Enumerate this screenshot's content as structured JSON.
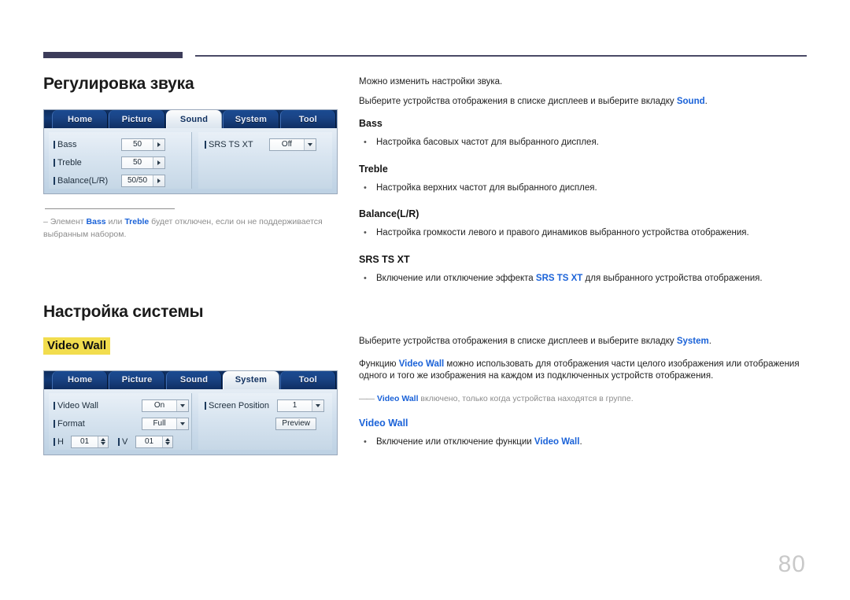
{
  "page": {
    "number": "80"
  },
  "sound_section": {
    "title": "Регулировка звука",
    "panel": {
      "tabs": [
        {
          "label": "Home",
          "active": false
        },
        {
          "label": "Picture",
          "active": false
        },
        {
          "label": "Sound",
          "active": true
        },
        {
          "label": "System",
          "active": false
        },
        {
          "label": "Tool",
          "active": false
        }
      ],
      "left_rows": [
        {
          "label": "Bass",
          "value": "50",
          "control": "stepper-right"
        },
        {
          "label": "Treble",
          "value": "50",
          "control": "stepper-right"
        },
        {
          "label": "Balance(L/R)",
          "value": "50/50",
          "control": "stepper-right"
        }
      ],
      "right_rows": [
        {
          "label": "SRS TS XT",
          "value": "Off",
          "control": "dropdown"
        }
      ]
    },
    "note": {
      "dash": "–",
      "part1": "Элемент ",
      "bold1": "Bass",
      "part2": " или ",
      "bold2": "Treble",
      "part3": " будет отключен, если он не поддерживается выбранным набором."
    }
  },
  "system_section": {
    "title": "Настройка системы",
    "highlight_label": "Video Wall",
    "panel": {
      "tabs": [
        {
          "label": "Home",
          "active": false
        },
        {
          "label": "Picture",
          "active": false
        },
        {
          "label": "Sound",
          "active": false
        },
        {
          "label": "System",
          "active": true
        },
        {
          "label": "Tool",
          "active": false
        }
      ],
      "left_rows": [
        {
          "label": "Video Wall",
          "value": "On",
          "control": "dropdown"
        },
        {
          "label": "Format",
          "value": "Full",
          "control": "dropdown"
        }
      ],
      "hv_row": {
        "h_label": "H",
        "h_value": "01",
        "v_label": "V",
        "v_value": "01"
      },
      "right_rows": [
        {
          "label": "Screen Position",
          "value": "1",
          "control": "dropdown"
        }
      ],
      "preview_button": "Preview"
    }
  },
  "right_column": {
    "sound_intro_1": "Можно изменить настройки звука.",
    "sound_intro_2_pre": "Выберите устройства отображения в списке дисплеев и выберите вкладку ",
    "sound_intro_2_link": "Sound",
    "sound_intro_2_post": ".",
    "items": [
      {
        "heading": "Bass",
        "bullet_pre": "Настройка басовых частот для выбранного дисплея.",
        "bullet_link": "",
        "bullet_post": ""
      },
      {
        "heading": "Treble",
        "bullet_pre": "Настройка верхних частот для выбранного дисплея.",
        "bullet_link": "",
        "bullet_post": ""
      },
      {
        "heading": "Balance(L/R)",
        "bullet_pre": "Настройка громкости левого и правого динамиков выбранного устройства отображения.",
        "bullet_link": "",
        "bullet_post": ""
      },
      {
        "heading": "SRS TS XT",
        "bullet_pre": "Включение или отключение эффекта ",
        "bullet_link": "SRS TS XT",
        "bullet_post": " для выбранного устройства отображения."
      }
    ],
    "system_intro_pre": "Выберите устройства отображения в списке дисплеев и выберите вкладку ",
    "system_intro_link": "System",
    "system_intro_post": ".",
    "videowall_para_pre": "Функцию ",
    "videowall_para_link": "Video Wall",
    "videowall_para_post": " можно использовать для отображения части целого изображения или отображения одного и того же изображения на каждом из подключенных устройств отображения.",
    "videowall_note": {
      "lead": "――",
      "bold": "Video Wall",
      "text": " включено, только когда устройства находятся в группе."
    },
    "videowall_heading": "Video Wall",
    "videowall_bullet_pre": "Включение или отключение функции ",
    "videowall_bullet_link": "Video Wall",
    "videowall_bullet_post": "."
  },
  "bullet_marker": "•",
  "colors": {
    "link_blue": "#1a62d8",
    "highlight_yellow": "#f2dd4e",
    "header_navy": "#3c3c5a",
    "page_number_gray": "#c9c9c9"
  }
}
